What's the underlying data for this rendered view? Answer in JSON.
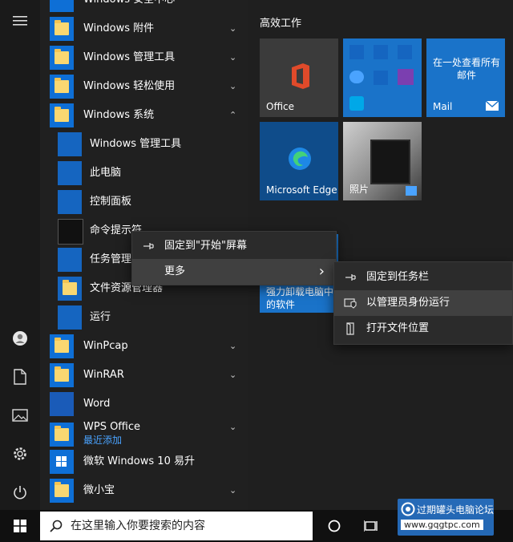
{
  "start_menu": {
    "rail_icons": [
      "hamburger-icon",
      "user-icon",
      "document-icon",
      "pictures-icon",
      "settings-icon",
      "power-icon"
    ],
    "app_list": {
      "partial_top": "Windows 安全中心",
      "items": [
        {
          "label": "Windows 附件",
          "type": "folder",
          "chevron": "⌄"
        },
        {
          "label": "Windows 管理工具",
          "type": "folder",
          "chevron": "⌄"
        },
        {
          "label": "Windows 轻松使用",
          "type": "folder",
          "chevron": "⌄"
        },
        {
          "label": "Windows 系统",
          "type": "folder",
          "chevron": "⌃"
        },
        {
          "label": "Windows 管理工具",
          "type": "sub"
        },
        {
          "label": "此电脑",
          "type": "sub"
        },
        {
          "label": "控制面板",
          "type": "sub"
        },
        {
          "label": "命令提示符",
          "type": "sub"
        },
        {
          "label": "任务管理器",
          "type": "sub"
        },
        {
          "label": "文件资源管理器",
          "type": "sub"
        },
        {
          "label": "运行",
          "type": "sub"
        },
        {
          "label": "WinPcap",
          "type": "folder",
          "chevron": "⌄"
        },
        {
          "label": "WinRAR",
          "type": "folder",
          "chevron": "⌄"
        },
        {
          "label": "Word",
          "type": "app"
        },
        {
          "label": "WPS Office",
          "type": "folder",
          "chevron": "⌄",
          "sub": "最近添加"
        },
        {
          "label": "微软 Windows 10 易升",
          "type": "app"
        },
        {
          "label": "微小宝",
          "type": "folder",
          "chevron": "⌄"
        }
      ]
    },
    "tiles": {
      "group_title": "高效工作",
      "office": "Office",
      "mail_text": "在一处查看所有邮件",
      "mail": "Mail",
      "edge": "Microsoft Edge",
      "photos": "照片",
      "partial_tile": "强力卸载电脑中的软件"
    },
    "context_menu": {
      "pin_start": "固定到\"开始\"屏幕",
      "more": "更多",
      "more_arrow": "›"
    },
    "submenu": {
      "pin_taskbar": "固定到任务栏",
      "run_admin": "以管理员身份运行",
      "open_location": "打开文件位置"
    }
  },
  "taskbar": {
    "search_placeholder": "在这里输入你要搜索的内容"
  },
  "watermark": {
    "title": "过期罐头电脑论坛",
    "url": "www.gqgtpc.com"
  },
  "colors": {
    "accent": "#0e6fd6",
    "tile_blue": "#1a73c9",
    "office_tile": "#3b3b3b",
    "menu_bg": "#2b2b2b",
    "highlight": "#404040"
  }
}
